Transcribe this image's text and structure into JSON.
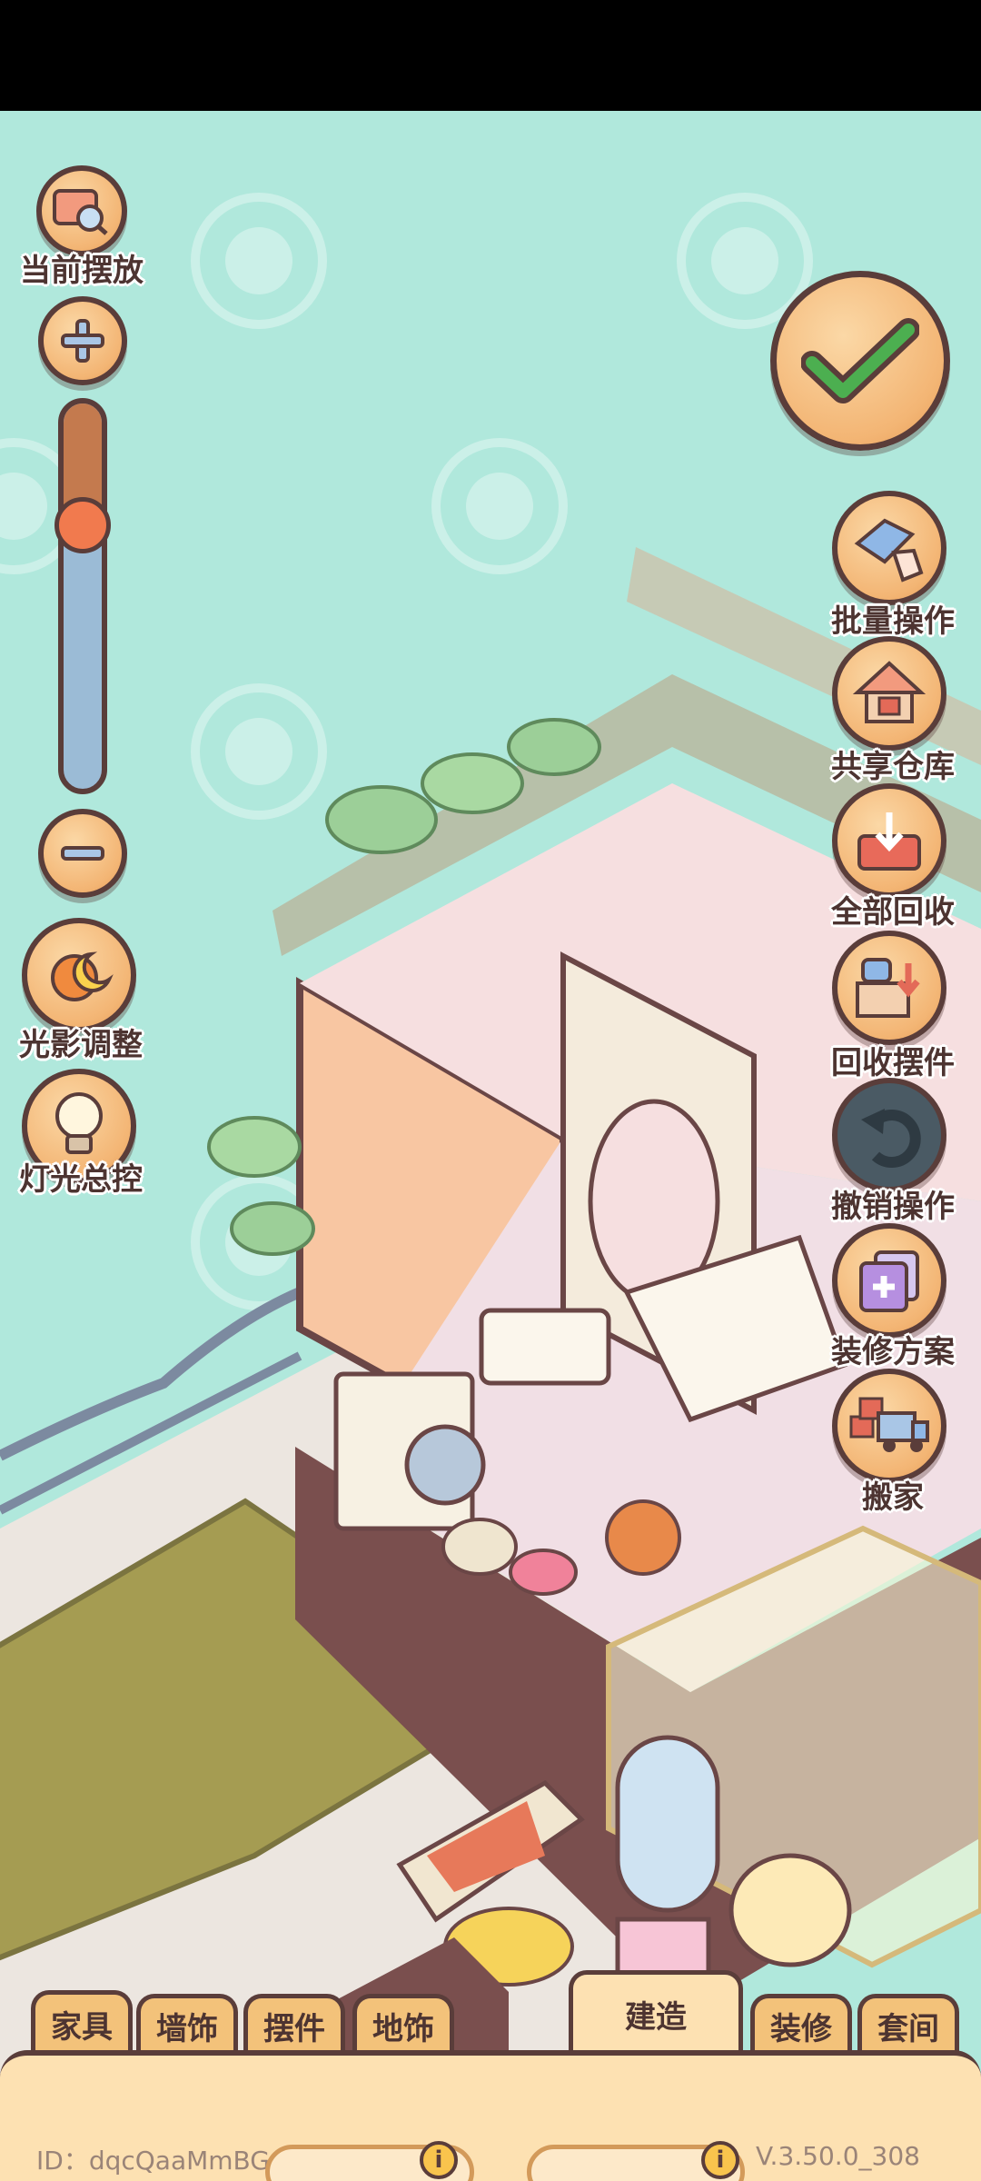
{
  "left_controls": {
    "current_placement": "当前摆放",
    "zoom_level_fraction": 0.32,
    "light_shadow": "光影调整",
    "light_control": "灯光总控"
  },
  "right_controls": {
    "batch": "批量操作",
    "shared_storage": "共享仓库",
    "recycle_all": "全部回收",
    "recycle_placed": "回收摆件",
    "undo": "撤销操作",
    "decor_plan": "装修方案",
    "move_house": "搬家"
  },
  "tabs": {
    "furniture": "家具",
    "wall_decor": "墙饰",
    "ornaments": "摆件",
    "floor_decor": "地饰",
    "build": "建造",
    "renovate": "装修",
    "suite": "套间"
  },
  "footer": {
    "id_text": "ID：dqcQaaMmBGaE",
    "version": "V.3.50.0_308"
  },
  "colors": {
    "sky": "#b0e8dc",
    "button": "#f3b574",
    "outline": "#5a3d3a",
    "confirm_check": "#4caf50"
  }
}
